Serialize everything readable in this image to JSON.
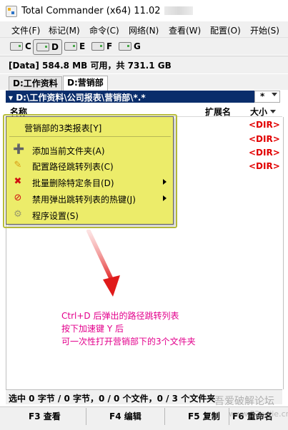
{
  "window": {
    "title": "Total Commander (x64) 11.02"
  },
  "menu": [
    "文件(F)",
    "标记(M)",
    "命令(C)",
    "网络(N)",
    "查看(W)",
    "配置(O)",
    "开始(S)"
  ],
  "drives": [
    {
      "letter": "C",
      "icon": "hard-drive-icon"
    },
    {
      "letter": "D",
      "icon": "hard-drive-icon",
      "selected": true
    },
    {
      "letter": "E",
      "icon": "hard-drive-icon"
    },
    {
      "letter": "F",
      "icon": "hard-drive-icon"
    },
    {
      "letter": "G",
      "icon": "hard-drive-icon"
    }
  ],
  "drive_info": "[Data]  584.8 MB 可用，共 731.1 GB",
  "tabs": [
    "D:工作资料",
    "D:营销部"
  ],
  "path": "▾ D:\\工作资料\\公司报表\\营销部\\*.*",
  "filter": "*",
  "columns": {
    "name": "名称",
    "ext": "扩展名",
    "size": "大小"
  },
  "rows": [
    {
      "size": "<DIR>"
    },
    {
      "size": "<DIR>"
    },
    {
      "size": "<DIR>"
    },
    {
      "size": "<DIR>"
    }
  ],
  "popup_menu": {
    "header": "营销部的3类报表[Y]",
    "items": [
      {
        "label": "添加当前文件夹(A)",
        "icon": "add-circle-icon",
        "color": "#2aa02a"
      },
      {
        "label": "配置路径跳转列表(C)",
        "icon": "pencil-icon",
        "color": "#d89a10"
      },
      {
        "label": "批量删除特定条目(D)",
        "icon": "x-mark-icon",
        "color": "#d01010",
        "submenu": true
      },
      {
        "label": "禁用弹出跳转列表的热键(J)",
        "icon": "prohibit-icon",
        "color": "#d01010",
        "submenu": true
      },
      {
        "label": "程序设置(S)",
        "icon": "gear-icon",
        "color": "#b0b080"
      }
    ]
  },
  "annotation": [
    "Ctrl+D 后弹出的路径跳转列表",
    "按下加速键 Y 后",
    "可一次性打开营销部下的3个文件夹"
  ],
  "status": "选中 0 字节 / 0 字节，0 / 0 个文件，0 / 3 个文件夹",
  "fkeys": [
    "F3 查看",
    "F4 编辑",
    "F5 复制",
    "F6 重命名"
  ],
  "watermark": [
    "吾爱破解论坛",
    "www.52pojie.cn"
  ],
  "colors": {
    "path_bar": "#0a2d6b",
    "popup": "#ecec6a",
    "annotation": "#e3008c",
    "dir": "#e20000"
  }
}
